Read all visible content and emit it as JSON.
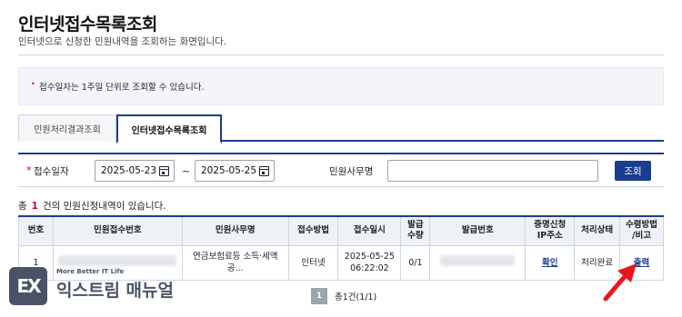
{
  "page": {
    "title": "인터넷접수목록조회",
    "subtitle": "인터넷으로 신청한 민원내역을 조회하는 화면입니다."
  },
  "notice": {
    "bullet": "•",
    "text": "접수일자는 1주일 단위로 조회할 수 있습니다."
  },
  "tabs": [
    {
      "label": "민원처리결과조회",
      "active": false
    },
    {
      "label": "인터넷접수목록조회",
      "active": true
    }
  ],
  "search": {
    "required_mark": "*",
    "date_label": "접수일자",
    "date_from": "2025-05-23",
    "date_separator": "~",
    "date_to": "2025-05-25",
    "office_label": "민원사무명",
    "office_value": "",
    "button_label": "조회"
  },
  "summary": {
    "prefix": "총",
    "count": "1",
    "suffix": "건의 민원신청내역이 있습니다."
  },
  "table": {
    "headers": {
      "no": "번호",
      "receipt_no": "민원접수번호",
      "office_name": "민원사무명",
      "method": "접수방법",
      "datetime": "접수일시",
      "issue_qty_1": "발급",
      "issue_qty_2": "수량",
      "issue_no": "발급번호",
      "cert_1": "증명신청",
      "cert_2": "IP주소",
      "status": "처리상태",
      "receive_1": "수령방법",
      "receive_2": "/비고"
    },
    "rows": [
      {
        "no": "1",
        "office_name": "연금보험료등 소득·세액공...",
        "method": "인터넷",
        "date": "2025-05-25",
        "time": "06:22:02",
        "qty": "0/1",
        "cert_link": "확인",
        "status": "처리완료",
        "receive_link": "출력"
      }
    ]
  },
  "pagination": {
    "current": "1",
    "summary": "총1건(1/1)"
  },
  "watermark": {
    "mark": "EX",
    "tagline": "More Better IT Life",
    "name": "익스트림 매뉴얼"
  },
  "colors": {
    "primary": "#1a3d8f",
    "required": "#d0021b",
    "arrow": "#e8161e"
  }
}
